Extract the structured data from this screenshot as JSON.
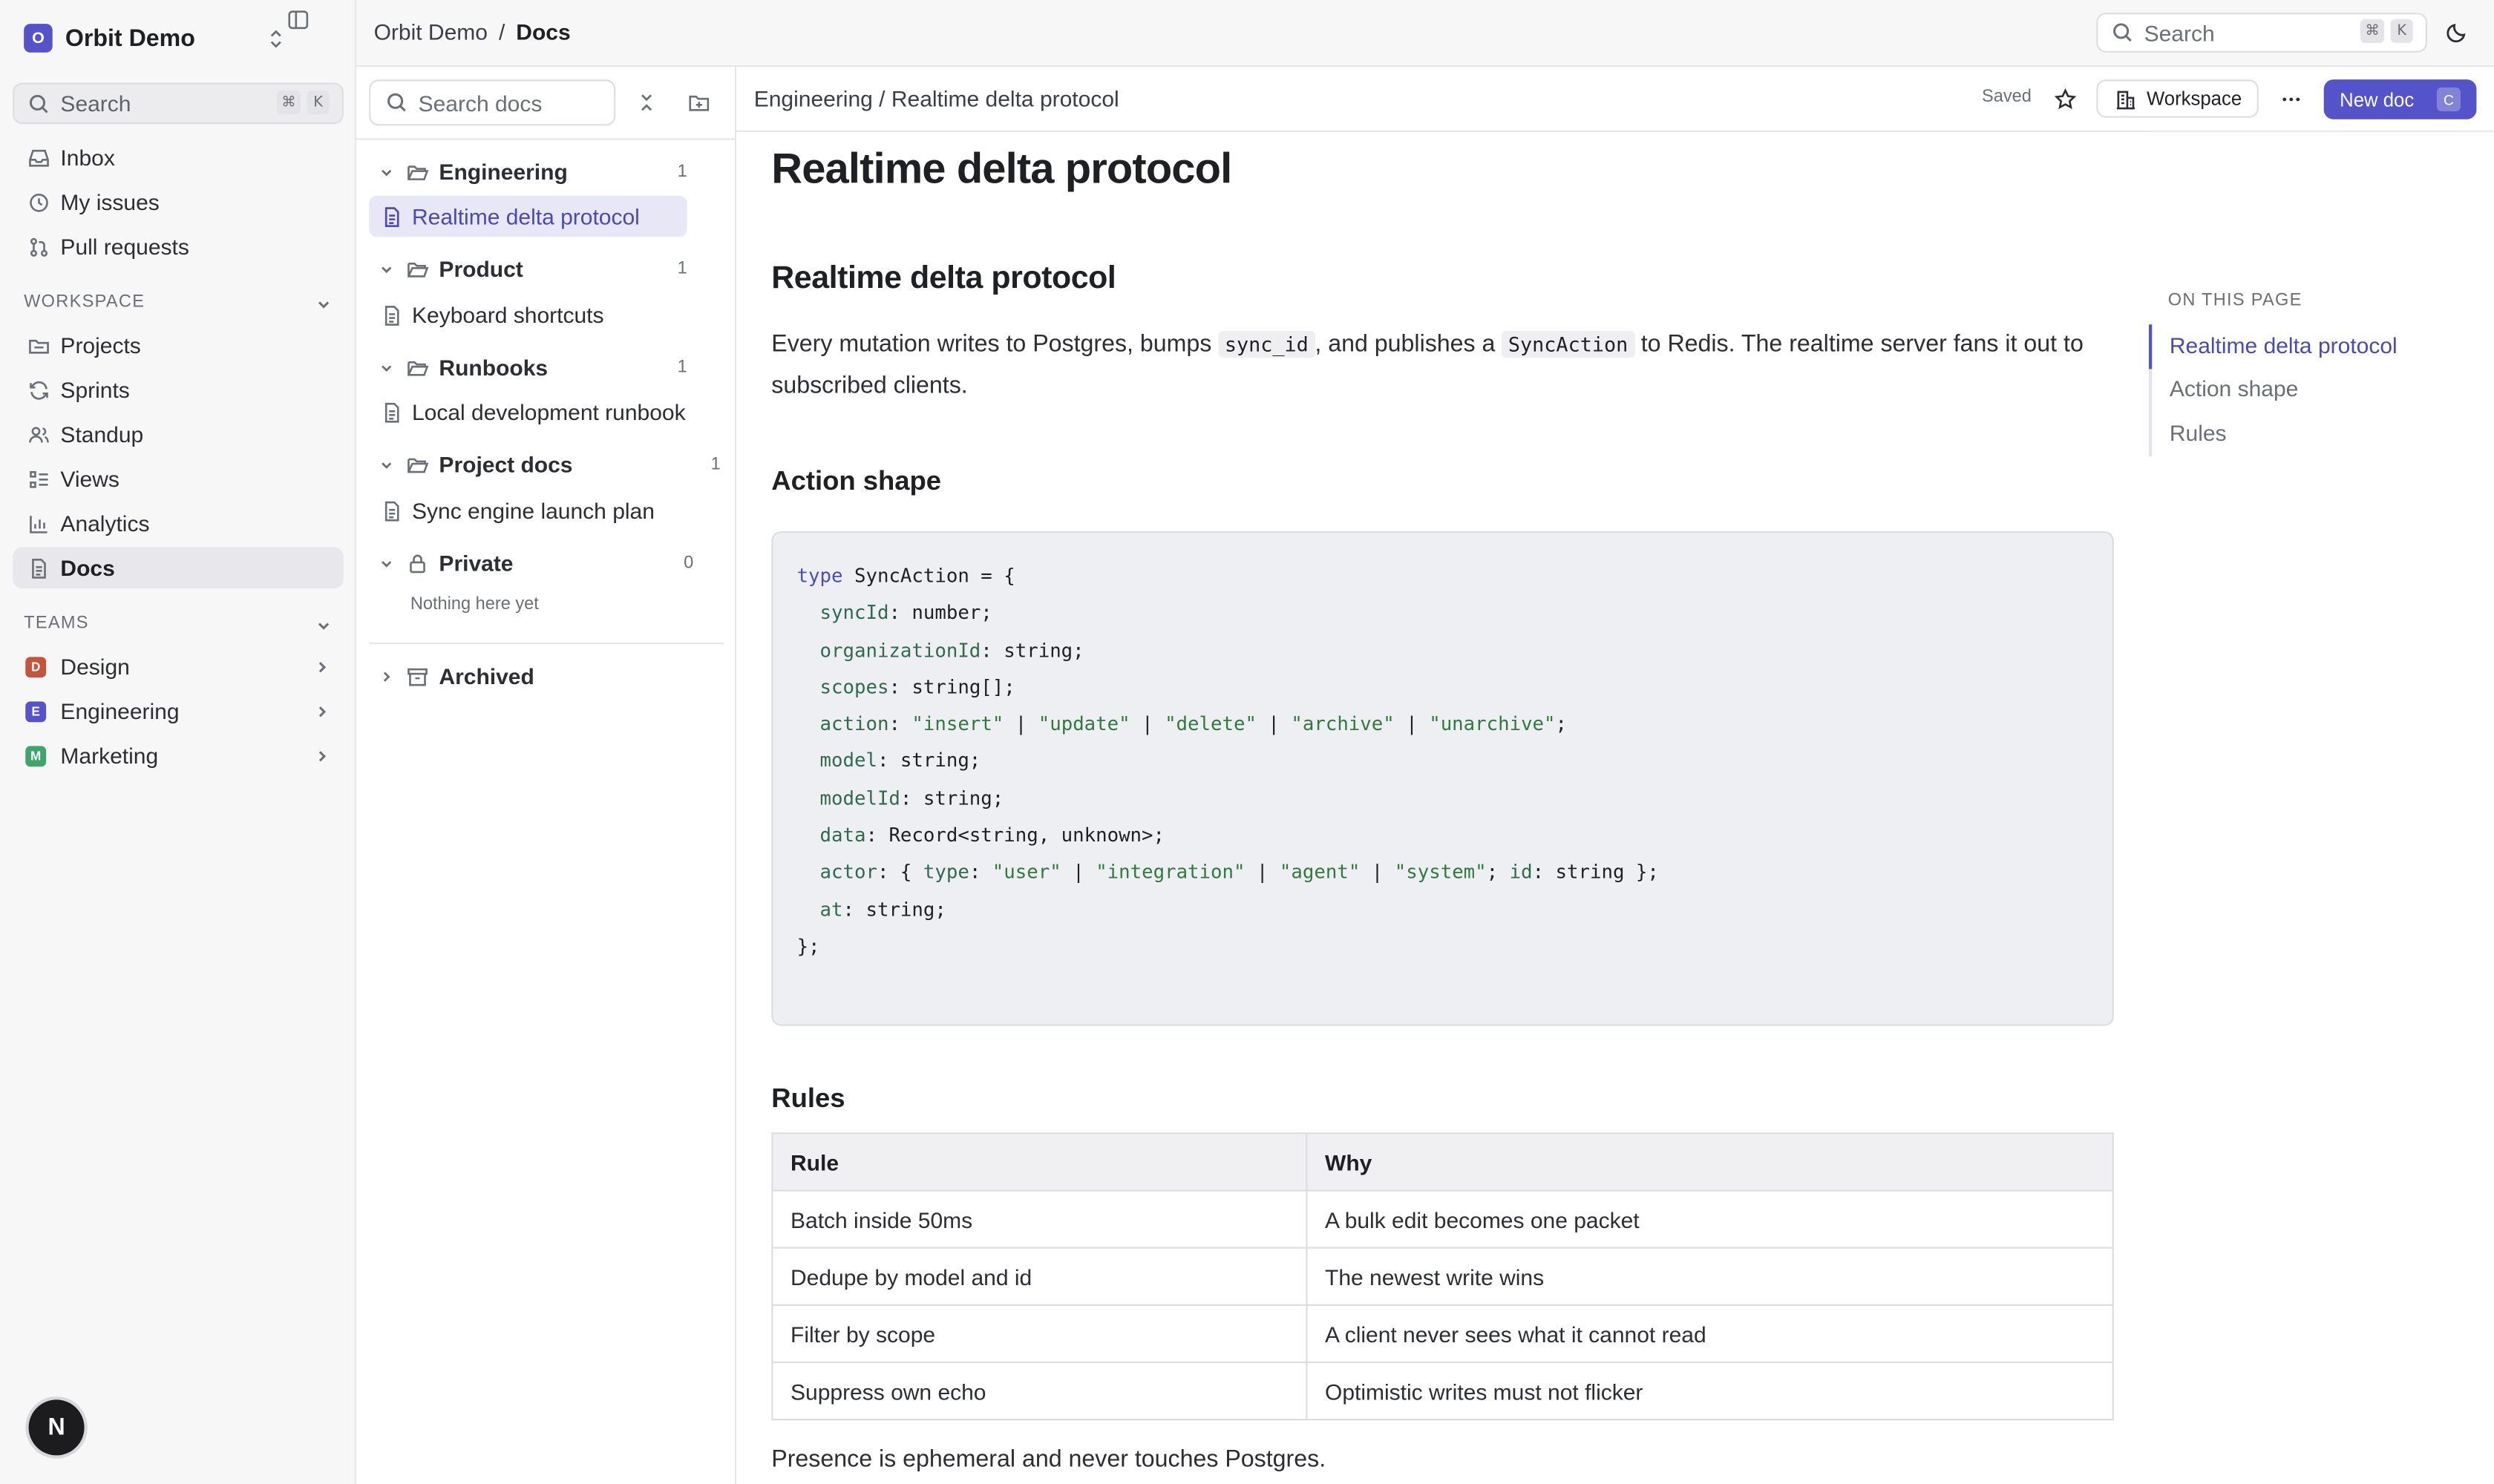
{
  "workspace": {
    "initial": "O",
    "name": "Orbit Demo"
  },
  "sidebar": {
    "search_label": "Search",
    "search_keys": [
      "⌘",
      "K"
    ],
    "primary": [
      {
        "label": "Inbox",
        "icon": "inbox-icon"
      },
      {
        "label": "My issues",
        "icon": "circle-dashed-icon"
      },
      {
        "label": "Pull requests",
        "icon": "git-pull-request-icon"
      }
    ],
    "workspace_heading": "WORKSPACE",
    "workspace_items": [
      {
        "label": "Projects",
        "icon": "folder-icon"
      },
      {
        "label": "Sprints",
        "icon": "refresh-icon"
      },
      {
        "label": "Standup",
        "icon": "users-icon"
      },
      {
        "label": "Views",
        "icon": "list-icon"
      },
      {
        "label": "Analytics",
        "icon": "bar-chart-icon"
      },
      {
        "label": "Docs",
        "icon": "document-icon",
        "active": true
      }
    ],
    "teams_heading": "TEAMS",
    "teams": [
      {
        "initial": "D",
        "label": "Design",
        "color": "#c2553a"
      },
      {
        "initial": "E",
        "label": "Engineering",
        "color": "#5453c9"
      },
      {
        "initial": "M",
        "label": "Marketing",
        "color": "#3fa56a"
      }
    ],
    "avatar_initial": "N"
  },
  "topbar": {
    "crumb_root": "Orbit Demo",
    "crumb_sep": "/",
    "crumb_current": "Docs",
    "search_label": "Search",
    "search_keys": [
      "⌘",
      "K"
    ]
  },
  "tree": {
    "search_placeholder": "Search docs",
    "folders": [
      {
        "label": "Engineering",
        "count": "1",
        "docs": [
          "Realtime delta protocol"
        ]
      },
      {
        "label": "Product",
        "count": "1",
        "docs": [
          "Keyboard shortcuts"
        ]
      },
      {
        "label": "Runbooks",
        "count": "1",
        "docs": [
          "Local development runbook"
        ]
      },
      {
        "label": "Project docs",
        "count": "1",
        "docs": [
          "Sync engine launch plan"
        ]
      },
      {
        "label": "Private",
        "count": "0",
        "docs": []
      }
    ],
    "empty_note": "Nothing here yet",
    "archived_label": "Archived"
  },
  "doc_header": {
    "breadcrumb": "Engineering / Realtime delta protocol",
    "status": "Saved",
    "workspace_button": "Workspace",
    "new_doc_button": "New doc",
    "new_doc_key": "C"
  },
  "doc": {
    "title": "Realtime delta protocol",
    "heading_1": "Realtime delta protocol",
    "intro": {
      "t1": "Every mutation writes to Postgres, bumps ",
      "code1": "sync_id",
      "t2": ", and publishes a ",
      "code2": "SyncAction",
      "t3": " to Redis. The realtime server fans it out to subscribed clients."
    },
    "heading_2": "Action shape",
    "code_lines": [
      "type SyncAction = {",
      "  syncId: number;",
      "  organizationId: string;",
      "  scopes: string[];",
      "  action: \"insert\" | \"update\" | \"delete\" | \"archive\" | \"unarchive\";",
      "  model: string;",
      "  modelId: string;",
      "  data: Record<string, unknown>;",
      "  actor: { type: \"user\" | \"integration\" | \"agent\" | \"system\"; id: string };",
      "  at: string;",
      "};"
    ],
    "heading_3": "Rules",
    "table": {
      "headers": [
        "Rule",
        "Why"
      ],
      "rows": [
        [
          "Batch inside 50ms",
          "A bulk edit becomes one packet"
        ],
        [
          "Dedupe by model and id",
          "The newest write wins"
        ],
        [
          "Filter by scope",
          "A client never sees what it cannot read"
        ],
        [
          "Suppress own echo",
          "Optimistic writes must not flicker"
        ]
      ]
    },
    "closing": "Presence is ephemeral and never touches Postgres."
  },
  "toc": {
    "heading": "ON THIS PAGE",
    "items": [
      "Realtime delta protocol",
      "Action shape",
      "Rules"
    ]
  },
  "colors": {
    "accent": "#5453c9",
    "active_doc_bg": "#e7e7f6"
  }
}
